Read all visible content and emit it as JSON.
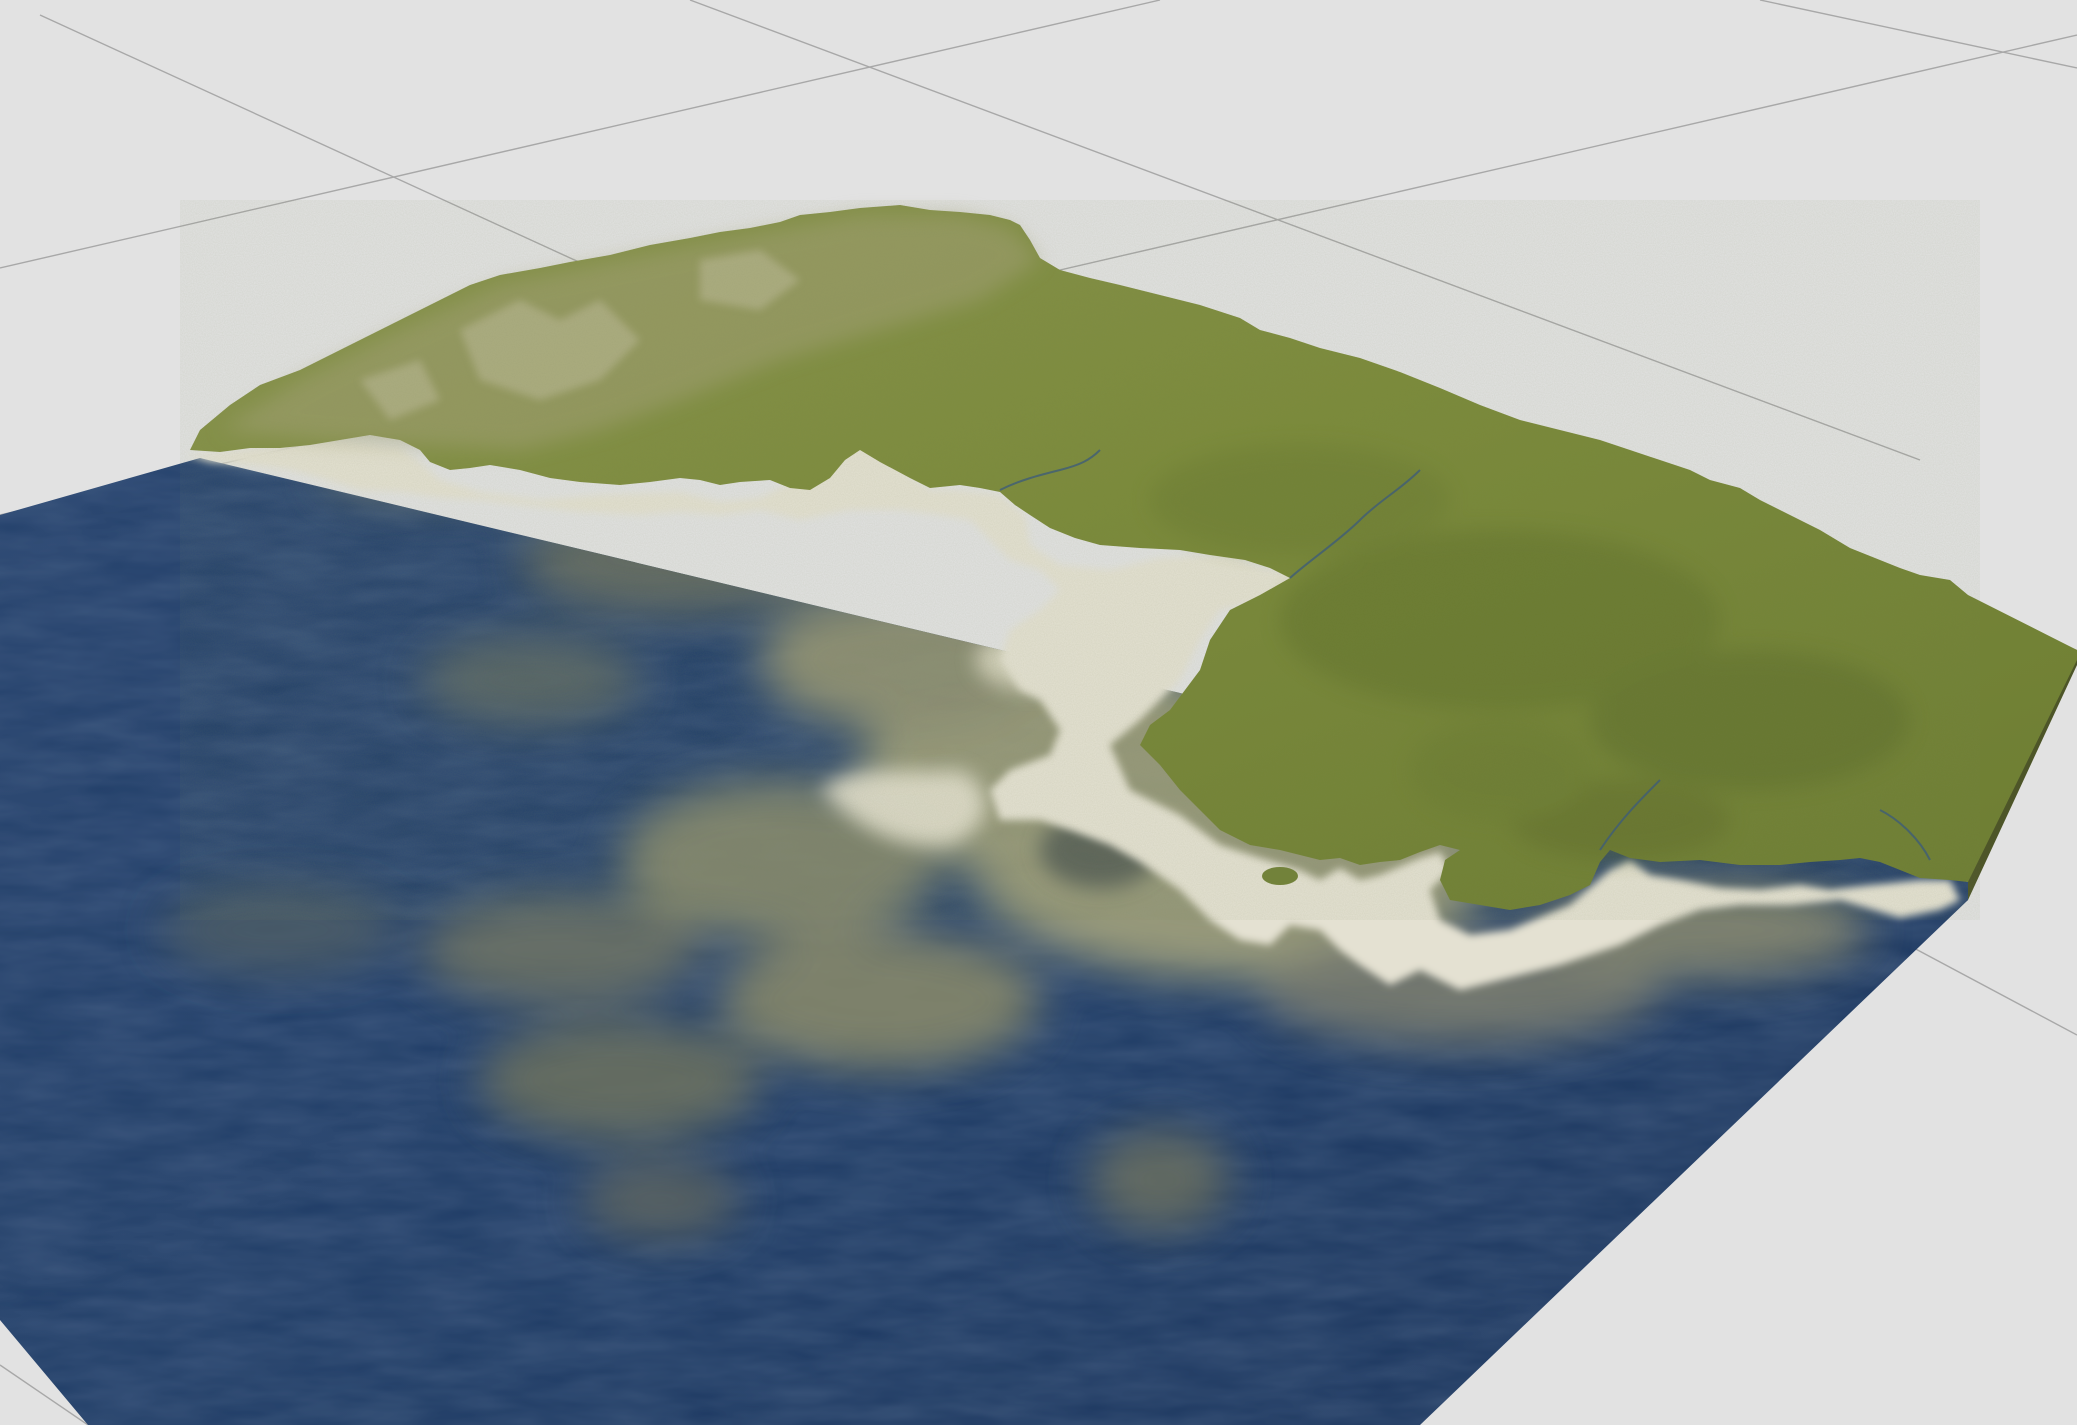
{
  "viewport": {
    "background_color": "#e2e2e2",
    "grid_line_color": "#a8a8a8",
    "grid_visible": true
  },
  "terrain": {
    "land_color": "#7f8c3c",
    "land_shadow_color": "#5f6b2c",
    "beach_color": "#e4e1d2",
    "shallow_water_color": "#a8a57a",
    "deep_water_color": "#1e3a62",
    "edge_color": "#50572a"
  }
}
